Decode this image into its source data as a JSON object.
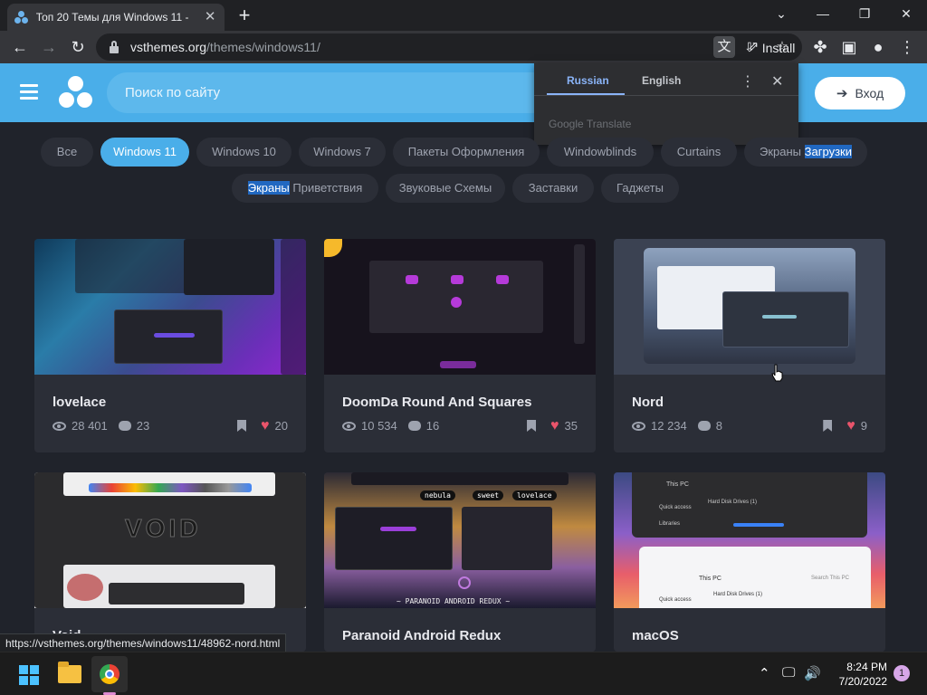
{
  "browser": {
    "tab_title": "Топ 20 Темы для Windows 11 - ",
    "tab_close": "✕",
    "new_tab": "+",
    "window_controls": {
      "minimize": "⌄",
      "minimize2": "—",
      "restore": "❐",
      "close": "✕"
    },
    "url_host": "vsthemes.org",
    "url_path": "/themes/windows11/",
    "install_label": "Install",
    "status_url": "https://vsthemes.org/themes/windows11/48962-nord.html"
  },
  "translate_popup": {
    "tab_source": "Russian",
    "tab_target": "English",
    "brand": "Google Translate"
  },
  "site": {
    "search_placeholder": "Поиск по сайту",
    "login_label": "Вход"
  },
  "filters": {
    "row1": [
      "Все",
      "Windows 11",
      "Windows 10",
      "Windows 7",
      "Пакеты Оформления",
      "Windowblinds",
      "Curtains"
    ],
    "row1_last_a": "Экраны",
    "row1_last_b": "Загрузки",
    "row2_first_a": "Экраны",
    "row2_first_b": "Приветствия",
    "row2": [
      "Звуковые Схемы",
      "Заставки",
      "Гаджеты"
    ],
    "active": "Windows 11"
  },
  "cards": [
    {
      "title": "lovelace",
      "views": "28 401",
      "comments": "23",
      "likes": "20"
    },
    {
      "title": "DoomDa Round And Squares",
      "views": "10 534",
      "comments": "16",
      "likes": "35"
    },
    {
      "title": "Nord",
      "views": "12 234",
      "comments": "8",
      "likes": "9"
    },
    {
      "title": "Void",
      "views": "",
      "comments": "",
      "likes": ""
    },
    {
      "title": "Paranoid Android Redux",
      "views": "",
      "comments": "",
      "likes": ""
    },
    {
      "title": "macOS",
      "views": "",
      "comments": "",
      "likes": ""
    }
  ],
  "thumb_text": {
    "void_logo": "VOID",
    "para_tags": [
      "nebula",
      "sweet",
      "lovelace"
    ],
    "para_caption": "~ PARANOID ANDROID REDUX ~",
    "mac_this_pc": "This PC",
    "mac_drives": "Hard Disk Drives (1)",
    "mac_quick": "Quick access",
    "mac_libraries": "Libraries",
    "mac_search": "Search This PC"
  },
  "taskbar": {
    "time": "8:24 PM",
    "date": "7/20/2022",
    "notifications": "1"
  },
  "colors": {
    "accent": "#4aaee9",
    "page_bg": "#20232b",
    "card_bg": "#2b2e37",
    "heart": "#e9546b"
  }
}
